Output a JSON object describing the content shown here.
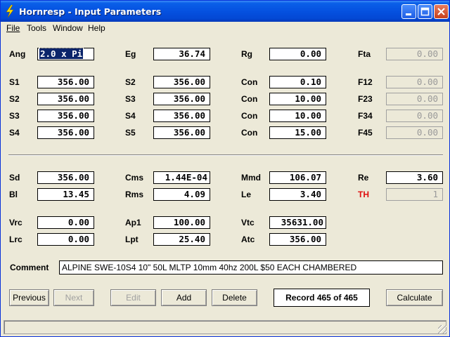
{
  "window": {
    "title": "Hornresp - Input Parameters"
  },
  "menu": [
    "File",
    "Tools",
    "Window",
    "Help"
  ],
  "params": {
    "Ang": {
      "label": "Ang",
      "value": "2.0 x Pi"
    },
    "Eg": {
      "label": "Eg",
      "value": "36.74"
    },
    "Rg": {
      "label": "Rg",
      "value": "0.00"
    },
    "Fta": {
      "label": "Fta",
      "value": "0.00"
    },
    "S1": {
      "label": "S1",
      "value": "356.00"
    },
    "S2a": {
      "label": "S2",
      "value": "356.00"
    },
    "Con1": {
      "label": "Con",
      "value": "0.10"
    },
    "F12": {
      "label": "F12",
      "value": "0.00"
    },
    "S2": {
      "label": "S2",
      "value": "356.00"
    },
    "S3a": {
      "label": "S3",
      "value": "356.00"
    },
    "Con2": {
      "label": "Con",
      "value": "10.00"
    },
    "F23": {
      "label": "F23",
      "value": "0.00"
    },
    "S3": {
      "label": "S3",
      "value": "356.00"
    },
    "S4a": {
      "label": "S4",
      "value": "356.00"
    },
    "Con3": {
      "label": "Con",
      "value": "10.00"
    },
    "F34": {
      "label": "F34",
      "value": "0.00"
    },
    "S4": {
      "label": "S4",
      "value": "356.00"
    },
    "S5": {
      "label": "S5",
      "value": "356.00"
    },
    "Con4": {
      "label": "Con",
      "value": "15.00"
    },
    "F45": {
      "label": "F45",
      "value": "0.00"
    },
    "Sd": {
      "label": "Sd",
      "value": "356.00"
    },
    "Cms": {
      "label": "Cms",
      "value": "1.44E-04"
    },
    "Mmd": {
      "label": "Mmd",
      "value": "106.07"
    },
    "Re": {
      "label": "Re",
      "value": "3.60"
    },
    "Bl": {
      "label": "Bl",
      "value": "13.45"
    },
    "Rms": {
      "label": "Rms",
      "value": "4.09"
    },
    "Le": {
      "label": "Le",
      "value": "3.40"
    },
    "TH": {
      "label": "TH",
      "value": "1"
    },
    "Vrc": {
      "label": "Vrc",
      "value": "0.00"
    },
    "Ap1": {
      "label": "Ap1",
      "value": "100.00"
    },
    "Vtc": {
      "label": "Vtc",
      "value": "35631.00"
    },
    "Lrc": {
      "label": "Lrc",
      "value": "0.00"
    },
    "Lpt": {
      "label": "Lpt",
      "value": "25.40"
    },
    "Atc": {
      "label": "Atc",
      "value": "356.00"
    }
  },
  "comment": {
    "label": "Comment",
    "value": "ALPINE SWE-10S4 10\" 50L MLTP 10mm 40hz 200L $50 EACH CHAMBERED"
  },
  "buttons": {
    "previous": "Previous",
    "next": "Next",
    "edit": "Edit",
    "add": "Add",
    "delete": "Delete",
    "calculate": "Calculate"
  },
  "record": "Record 465 of 465",
  "colors": {
    "title_bar": "#0551e0",
    "th_label": "#e01010",
    "selection": "#0a246a"
  }
}
